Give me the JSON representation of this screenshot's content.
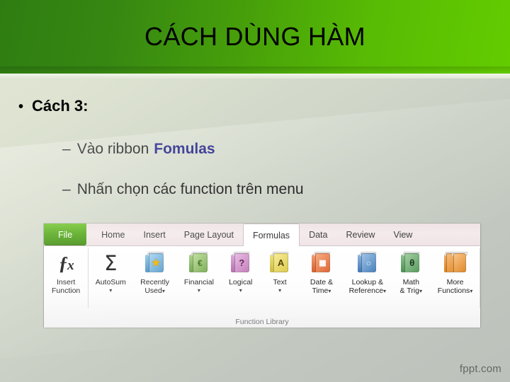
{
  "slide": {
    "title": "CÁCH DÙNG HÀM",
    "watermark": "fppt.com",
    "colors": {
      "header_green_dark": "#2f7d12",
      "header_green_light": "#63cc00",
      "background_light": "#e2e7d5",
      "background_gray": "#bcc2bb",
      "keyword_blue": "#161680",
      "file_tab_green": "#52a717"
    }
  },
  "bullets": {
    "level1": {
      "marker": "•",
      "text": "Cách 3:"
    },
    "level2": [
      {
        "marker": "–",
        "text": "Vào ribbon",
        "keyword": "Fomulas"
      },
      {
        "marker": "–",
        "text": "Nhấn chọn các function trên menu",
        "keyword": ""
      }
    ]
  },
  "ribbon": {
    "tabs": [
      {
        "label": "File",
        "active": false,
        "file": true
      },
      {
        "label": "Home",
        "active": false,
        "file": false
      },
      {
        "label": "Insert",
        "active": false,
        "file": false
      },
      {
        "label": "Page Layout",
        "active": false,
        "file": false
      },
      {
        "label": "Formulas",
        "active": true,
        "file": false
      },
      {
        "label": "Data",
        "active": false,
        "file": false
      },
      {
        "label": "Review",
        "active": false,
        "file": false
      },
      {
        "label": "View",
        "active": false,
        "file": false
      }
    ],
    "group_label": "Function Library",
    "commands": [
      {
        "id": "insert-function",
        "line1": "Insert",
        "line2": "Function",
        "icon": "fx-icon",
        "caret": false
      },
      {
        "id": "autosum",
        "line1": "AutoSum",
        "line2": "",
        "icon": "sigma-icon",
        "caret": true
      },
      {
        "id": "recently-used",
        "line1": "Recently",
        "line2": "Used",
        "icon": "book-star-icon",
        "caret": true
      },
      {
        "id": "financial",
        "line1": "Financial",
        "line2": "",
        "icon": "book-money-icon",
        "caret": true
      },
      {
        "id": "logical",
        "line1": "Logical",
        "line2": "",
        "icon": "book-question-icon",
        "caret": true
      },
      {
        "id": "text",
        "line1": "Text",
        "line2": "",
        "icon": "book-letter-a-icon",
        "caret": true
      },
      {
        "id": "date-time",
        "line1": "Date &",
        "line2": "Time",
        "icon": "book-calendar-icon",
        "caret": true
      },
      {
        "id": "lookup-reference",
        "line1": "Lookup &",
        "line2": "Reference",
        "icon": "book-magnifier-icon",
        "caret": true
      },
      {
        "id": "math-trig",
        "line1": "Math",
        "line2": "& Trig",
        "icon": "book-theta-icon",
        "caret": true
      },
      {
        "id": "more-functions",
        "line1": "More",
        "line2": "Functions",
        "icon": "books-stack-icon",
        "caret": true
      }
    ],
    "glyphs": {
      "fx": "ƒx",
      "sigma": "Σ",
      "star": "★",
      "question": "?",
      "letter_a": "A",
      "theta": "θ",
      "caret": "▾",
      "calendar": "▦",
      "magnifier": "●"
    }
  }
}
